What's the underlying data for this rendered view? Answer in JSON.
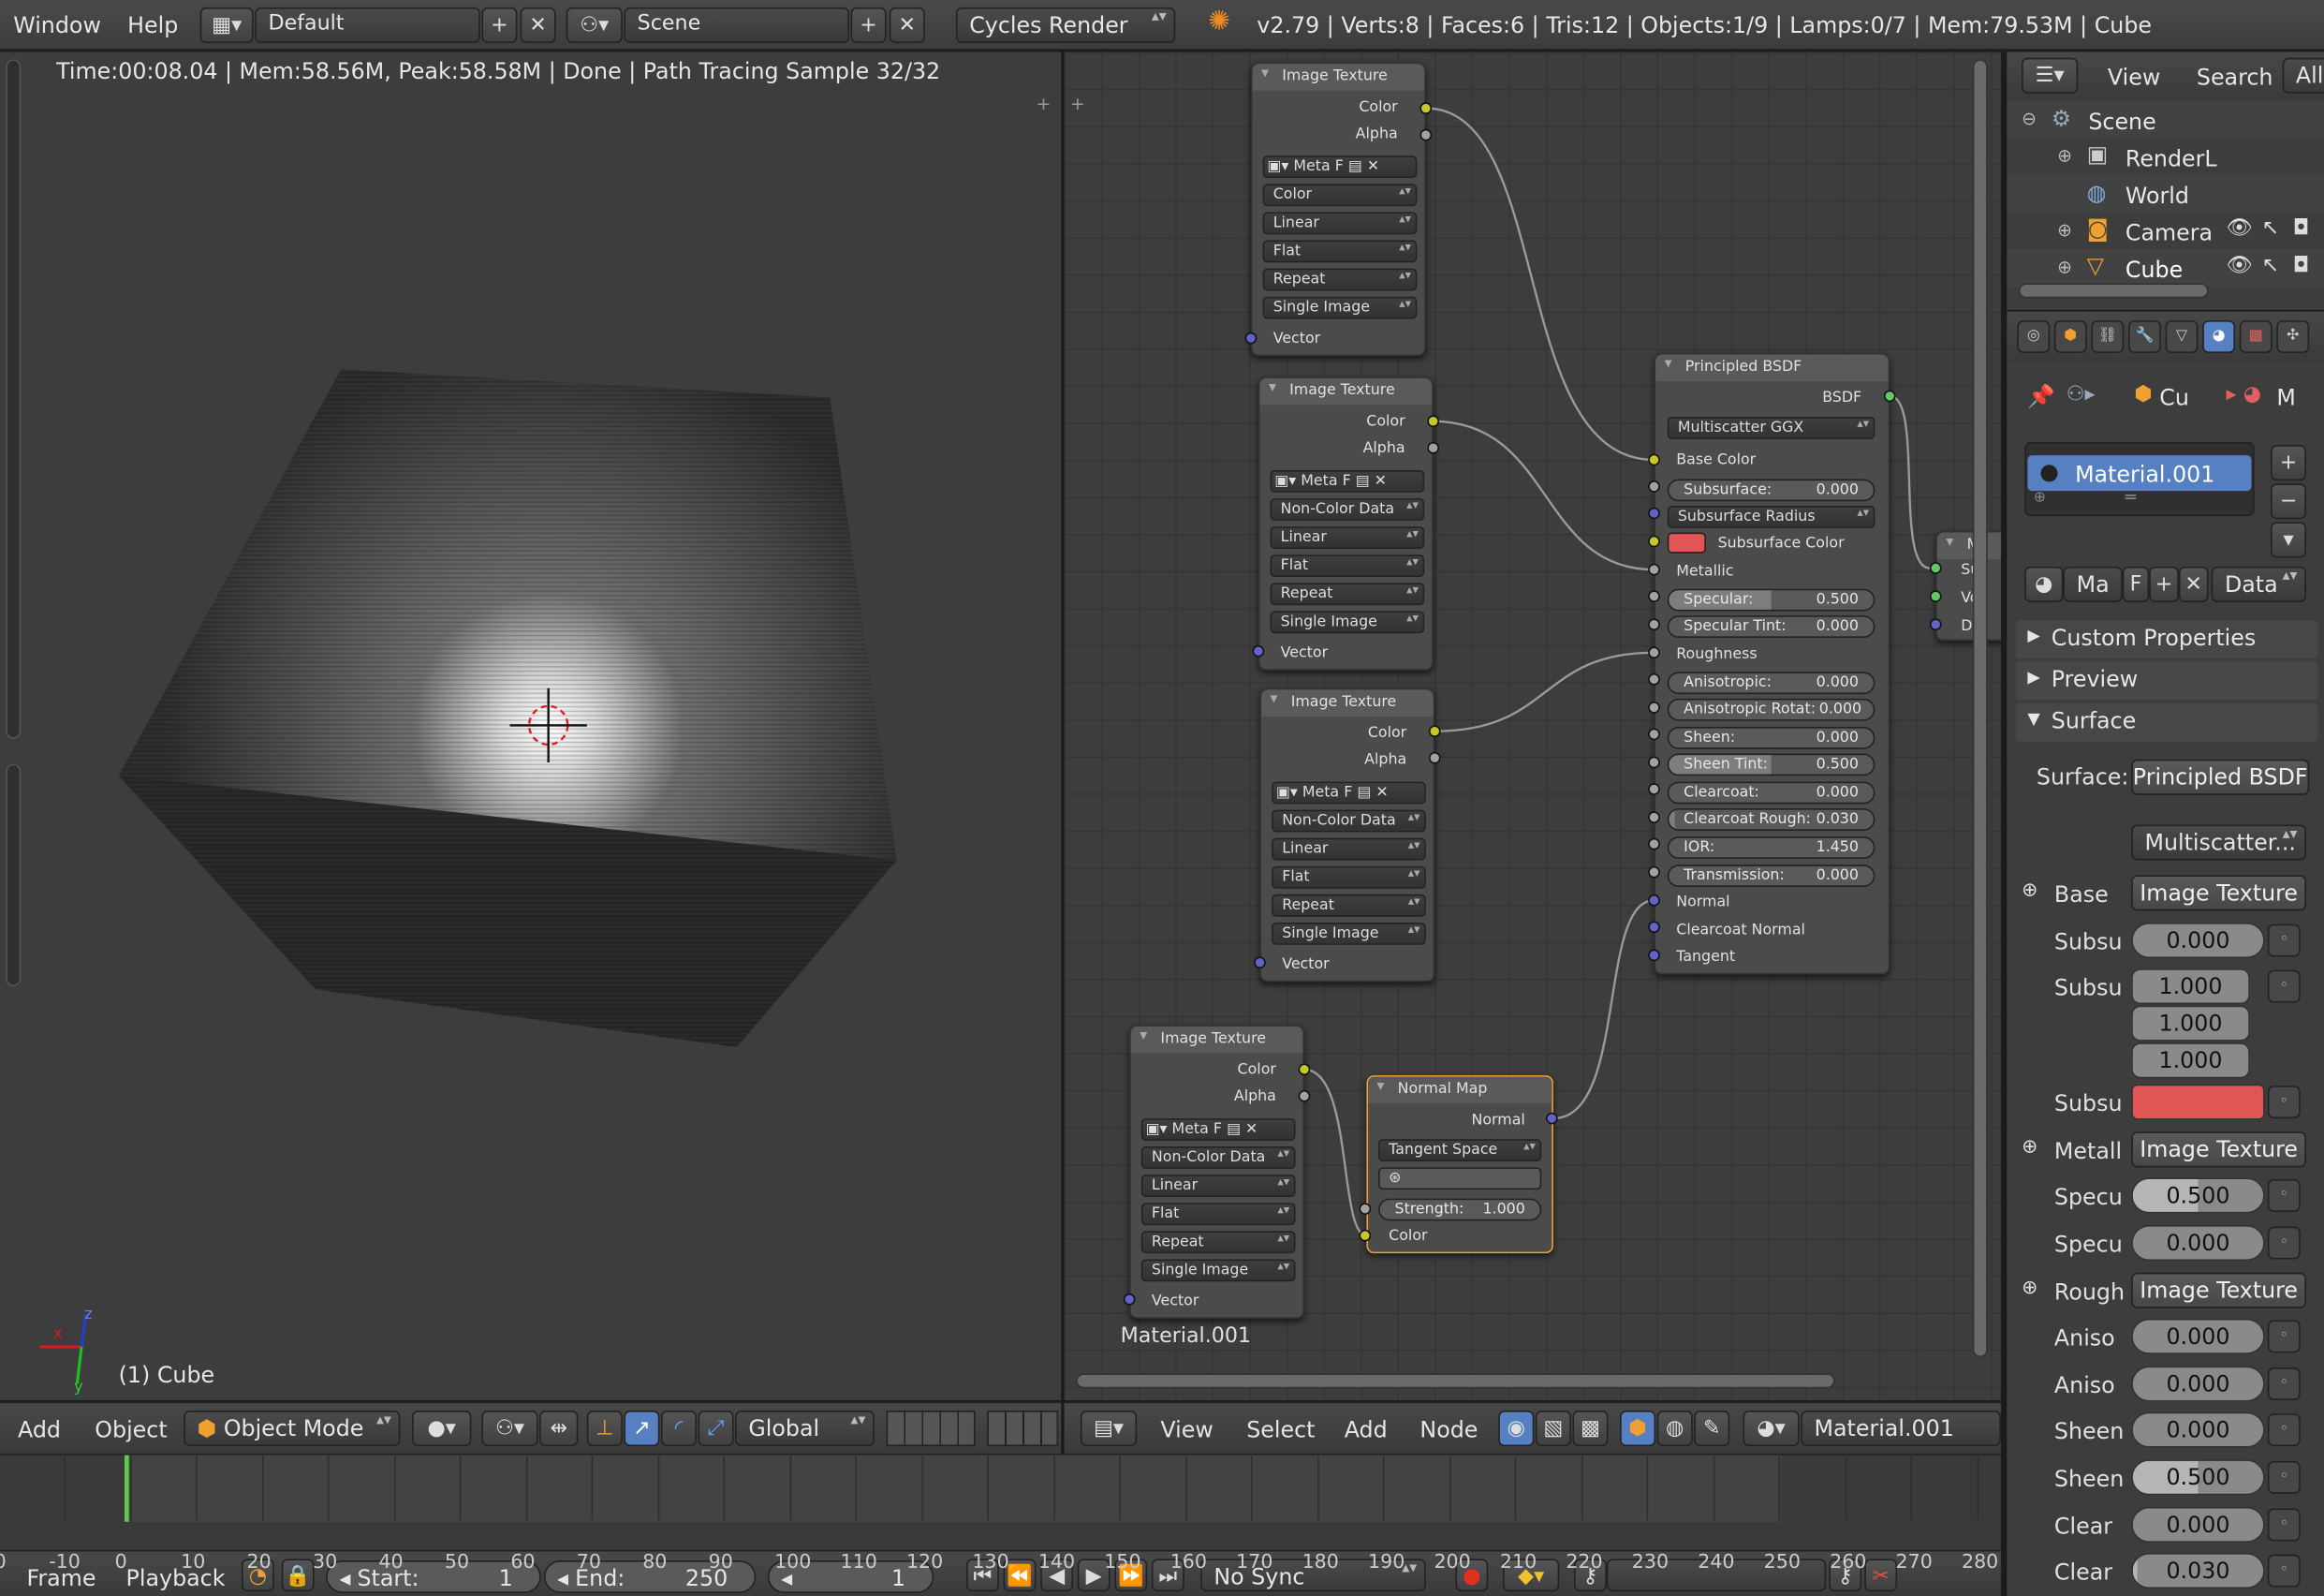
{
  "topbar": {
    "menus": [
      "Window",
      "Help"
    ],
    "layout": "Default",
    "scene": "Scene",
    "engine": "Cycles Render",
    "info": "v2.79 | Verts:8 | Faces:6 | Tris:12 | Objects:1/9 | Lamps:0/7 | Mem:79.53M | Cube"
  },
  "viewport": {
    "status": "Time:00:08.04 | Mem:58.56M, Peak:58.58M | Done | Path Tracing Sample 32/32",
    "object_label": "(1) Cube",
    "axis_x": "x",
    "axis_z": "z",
    "axis_y": "y"
  },
  "viewport_header": {
    "menus": [
      "Add",
      "Object"
    ],
    "mode": "Object Mode",
    "orientation": "Global"
  },
  "nodes": {
    "tex1": {
      "title": "Image Texture",
      "outputs": [
        "Color",
        "Alpha"
      ],
      "meta": "Meta",
      "f": "F",
      "options": [
        "Color",
        "Linear",
        "Flat",
        "Repeat",
        "Single Image"
      ],
      "input": "Vector"
    },
    "tex2": {
      "title": "Image Texture",
      "outputs": [
        "Color",
        "Alpha"
      ],
      "meta": "Meta",
      "f": "F",
      "options": [
        "Non-Color Data",
        "Linear",
        "Flat",
        "Repeat",
        "Single Image"
      ],
      "input": "Vector"
    },
    "tex3": {
      "title": "Image Texture",
      "outputs": [
        "Color",
        "Alpha"
      ],
      "meta": "Meta",
      "f": "F",
      "options": [
        "Non-Color Data",
        "Linear",
        "Flat",
        "Repeat",
        "Single Image"
      ],
      "input": "Vector"
    },
    "tex4": {
      "title": "Image Texture",
      "outputs": [
        "Color",
        "Alpha"
      ],
      "meta": "Meta",
      "f": "F",
      "options": [
        "Non-Color Data",
        "Linear",
        "Flat",
        "Repeat",
        "Single Image"
      ],
      "input": "Vector"
    },
    "normalmap": {
      "title": "Normal Map",
      "output": "Normal",
      "space": "Tangent Space",
      "strength_label": "Strength:",
      "strength": "1.000",
      "input": "Color"
    },
    "bsdf": {
      "title": "Principled BSDF",
      "output": "BSDF",
      "distribution": "Multiscatter GGX",
      "base_color": "Base Color",
      "subsurface_label": "Subsurface:",
      "subsurface": "0.000",
      "subsurface_radius": "Subsurface Radius",
      "subsurface_color": "Subsurface Color",
      "subsurface_color_hex": "#e05555",
      "metallic": "Metallic",
      "specular_label": "Specular:",
      "specular": "0.500",
      "spec_tint_label": "Specular Tint:",
      "spec_tint": "0.000",
      "roughness": "Roughness",
      "aniso_label": "Anisotropic:",
      "aniso": "0.000",
      "aniso_rot_label": "Anisotropic Rotat:",
      "aniso_rot": "0.000",
      "sheen_label": "Sheen:",
      "sheen": "0.000",
      "sheen_tint_label": "Sheen Tint:",
      "sheen_tint": "0.500",
      "clearcoat_label": "Clearcoat:",
      "clearcoat": "0.000",
      "cc_rough_label": "Clearcoat Rough:",
      "cc_rough": "0.030",
      "ior_label": "IOR:",
      "ior": "1.450",
      "transmission_label": "Transmission:",
      "transmission": "0.000",
      "normal": "Normal",
      "clearcoat_normal": "Clearcoat Normal",
      "tangent": "Tangent"
    },
    "output_partial": {
      "title": "M",
      "inputs": [
        "Su",
        "Vo",
        "Di"
      ]
    },
    "material_label": "Material.001"
  },
  "node_header": {
    "menus": [
      "View",
      "Select",
      "Add",
      "Node"
    ],
    "material": "Material.001"
  },
  "outliner": {
    "menus": [
      "View",
      "Search",
      "All"
    ],
    "items": [
      "Scene",
      "RenderL",
      "World",
      "Camera",
      "Cube"
    ]
  },
  "properties": {
    "context": [
      "Cu",
      "M"
    ],
    "material_slot": "Material.001",
    "mat_short": "Ma",
    "f": "F",
    "data": "Data",
    "panels": [
      "Custom Properties",
      "Preview",
      "Surface"
    ],
    "surface_label": "Surface:",
    "surface_value": "Principled BSDF",
    "distribution": "Multiscatter...",
    "rows": [
      {
        "label": "Base",
        "type": "btn",
        "value": "Image Texture"
      },
      {
        "label": "Subsu",
        "type": "val",
        "value": "0.000"
      },
      {
        "label": "Subsu",
        "type": "vec",
        "values": [
          "1.000",
          "1.000",
          "1.000"
        ]
      },
      {
        "label": "Subsu",
        "type": "color",
        "value": "#e05555"
      },
      {
        "label": "Metall",
        "type": "btn",
        "value": "Image Texture"
      },
      {
        "label": "Specu",
        "type": "val",
        "value": "0.500"
      },
      {
        "label": "Specu",
        "type": "val",
        "value": "0.000"
      },
      {
        "label": "Rough",
        "type": "btn",
        "value": "Image Texture"
      },
      {
        "label": "Aniso",
        "type": "val",
        "value": "0.000"
      },
      {
        "label": "Aniso",
        "type": "val",
        "value": "0.000"
      },
      {
        "label": "Sheen",
        "type": "val",
        "value": "0.000"
      },
      {
        "label": "Sheen",
        "type": "val",
        "value": "0.500"
      },
      {
        "label": "Clear",
        "type": "val",
        "value": "0.000"
      },
      {
        "label": "Clear",
        "type": "val",
        "value": "0.030"
      }
    ]
  },
  "timeline": {
    "ticks": [
      "0",
      "-10",
      "0",
      "10",
      "20",
      "30",
      "40",
      "50",
      "60",
      "70",
      "80",
      "90",
      "100",
      "110",
      "120",
      "130",
      "140",
      "150",
      "160",
      "170",
      "180",
      "190",
      "200",
      "210",
      "220",
      "230",
      "240",
      "250",
      "260",
      "270",
      "280"
    ],
    "menus": [
      "Frame",
      "Playback"
    ],
    "start_label": "Start:",
    "start": "1",
    "end_label": "End:",
    "end": "250",
    "current": "1",
    "sync": "No Sync"
  },
  "colors": {
    "accent": "#5680c2",
    "playhead": "#5fc94a",
    "socket_yellow": "#c7c729",
    "socket_grey": "#a1a1a1",
    "socket_blue": "#6363c7",
    "socket_green": "#63c763"
  }
}
